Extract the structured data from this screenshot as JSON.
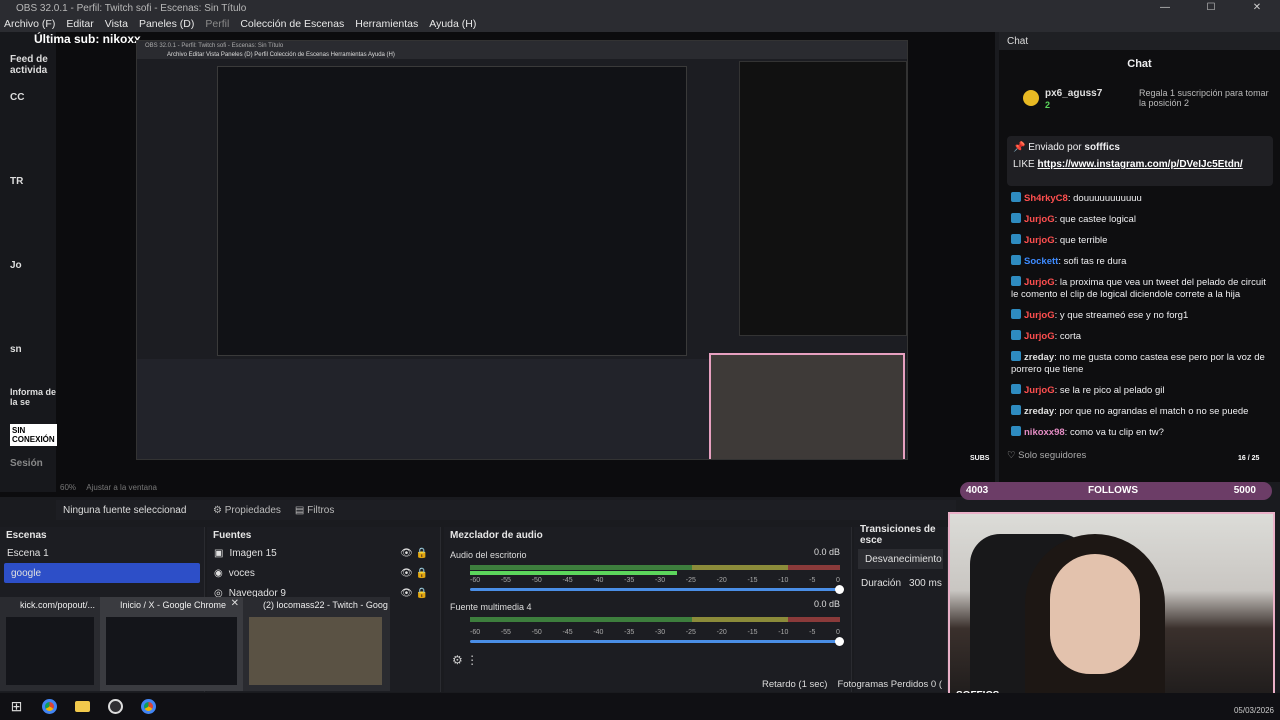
{
  "window": {
    "title": "OBS 32.0.1 - Perfil: Twitch sofi - Escenas: Sin Título",
    "min": "—",
    "max": "☐",
    "close": "✕"
  },
  "menu": [
    "Archivo (F)",
    "Editar",
    "Vista",
    "Paneles (D)",
    "Perfil",
    "Colección de Escenas",
    "Herramientas",
    "Ayuda (H)"
  ],
  "overlay": {
    "last_sub": "Última sub: nikoxx",
    "left_items": [
      "Feed de activida",
      "CC",
      "TR",
      "Jo",
      "sn",
      "Informa de la se",
      "SIN CONEXIÓN",
      "Sesión"
    ]
  },
  "preview": {
    "zoom": "60%",
    "fit_label": "Ajustar a la ventana",
    "nested_title": "OBS 32.0.1 - Perfil: Twitch sofi - Escenas: Sin Título",
    "nested_menu": "Archivo  Editar  Vista  Paneles (D)  Perfil  Colección de Escenas  Herramientas  Ayuda (H)"
  },
  "chat": {
    "dock_title": "Chat",
    "header": "Chat",
    "gift_user": "px6_aguss7",
    "gift_count": "2",
    "gift_desc": "Regala 1 suscripción para tomar la posición 2",
    "pinned_by": "Enviado por",
    "pinned_user": "sofffics",
    "pinned_text": "LIKE",
    "pinned_link": "https://www.instagram.com/p/DVeIJc5Etdn/",
    "messages": [
      {
        "user": "Sh4rkyC8",
        "text": ": douuuuuuuuuuu",
        "color": "#ff4f4f"
      },
      {
        "user": "JurjoG",
        "text": ": que castee logical",
        "color": "#ff4f4f"
      },
      {
        "user": "JurjoG",
        "text": ": que terrible",
        "color": "#ff4f4f"
      },
      {
        "user": "Sockett",
        "text": ": sofi tas re dura",
        "color": "#3e8bff"
      },
      {
        "user": "JurjoG",
        "text": ": la proxima que vea un tweet del pelado de circuit le comento el clip de logical diciendole correte a la hija",
        "color": "#ff4f4f"
      },
      {
        "user": "JurjoG",
        "text": ": y que streameó ese y no forg1",
        "color": "#ff4f4f"
      },
      {
        "user": "JurjoG",
        "text": ": corta",
        "color": "#ff4f4f"
      },
      {
        "user": "zreday",
        "text": ": no me gusta como castea ese pero por la voz de porrero que tiene",
        "color": "#e0e0e0"
      },
      {
        "user": "JurjoG",
        "text": ": se la re pico al pelado gil",
        "color": "#ff4f4f"
      },
      {
        "user": "zreday",
        "text": ": por que no agrandas el match o no se puede",
        "color": "#e0e0e0"
      },
      {
        "user": "nikoxx98",
        "text": ": como va tu clip en tw?",
        "color": "#e48cc4"
      }
    ],
    "followers_only": "Solo seguidores"
  },
  "alert": {
    "subs_label": "SUBS",
    "subs_count": "16 / 25",
    "count": "4003",
    "label": "FOLLOWS",
    "target": "5000"
  },
  "props": {
    "no_source": "Ninguna fuente seleccionad",
    "properties": "Propiedades",
    "filters": "Filtros"
  },
  "scenes": {
    "title": "Escenas",
    "items": [
      "Escena 1",
      "google"
    ]
  },
  "sources": {
    "title": "Fuentes",
    "items": [
      "Imagen 15",
      "voces",
      "Navegador 9"
    ]
  },
  "mixer": {
    "title": "Mezclador de audio",
    "tracks": [
      {
        "name": "Audio del escritorio",
        "db": "0.0 dB",
        "level": 0.53
      },
      {
        "name": "Fuente multimedia 4",
        "db": "0.0 dB",
        "level": 0.0
      }
    ],
    "scale": [
      "-60",
      "-55",
      "-50",
      "-45",
      "-40",
      "-35",
      "-30",
      "-25",
      "-20",
      "-15",
      "-10",
      "-5",
      "0"
    ]
  },
  "transitions": {
    "title": "Transiciones de esce",
    "type": "Desvanecimiento",
    "duration_label": "Duración",
    "duration": "300 ms"
  },
  "status": {
    "delay": "Retardo (1 sec)",
    "dropped": "Fotogramas Perdidos 0 ("
  },
  "thumbs": [
    {
      "title": "kick.com/popout/..."
    },
    {
      "title": "Inicio / X - Google Chrome"
    },
    {
      "title": "(2) locomass22 - Twitch - Goog..."
    }
  ],
  "webcam": {
    "tag": "SOFFICS"
  },
  "taskbar": {
    "date": "05/03/2026"
  }
}
